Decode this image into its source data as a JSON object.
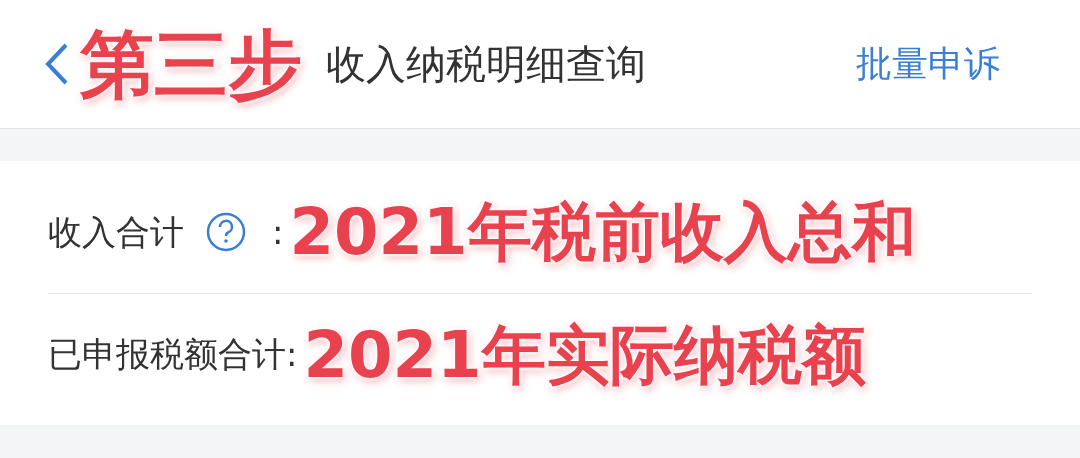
{
  "header": {
    "note": "第三步",
    "title": "收入纳税明细查询",
    "action": "批量申诉"
  },
  "rows": [
    {
      "label": "收入合计",
      "help": true,
      "colon": ":",
      "note": "2021年税前收入总和"
    },
    {
      "label": "已申报税额合计:",
      "help": false,
      "note": "2021年实际纳税额"
    }
  ]
}
